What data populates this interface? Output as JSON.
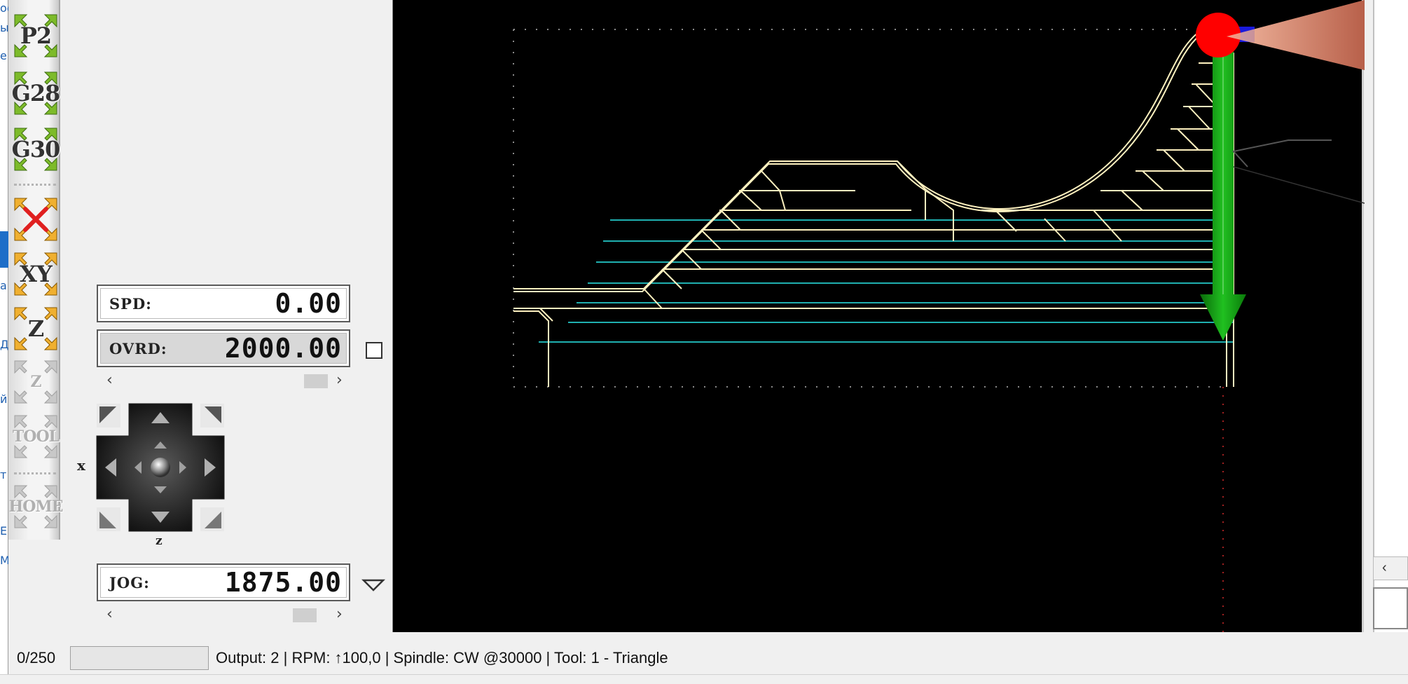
{
  "toolbar": {
    "icons": [
      {
        "label": "P2",
        "name": "p2-icon",
        "enabled": true
      },
      {
        "label": "G28",
        "name": "g28-icon",
        "enabled": true
      },
      {
        "label": "G30",
        "name": "g30-icon",
        "enabled": true
      },
      {
        "label": "",
        "name": "zero-all-icon",
        "enabled": true
      },
      {
        "label": "XY",
        "name": "zero-xy-icon",
        "enabled": true
      },
      {
        "label": "Z",
        "name": "zero-z-icon",
        "enabled": true
      },
      {
        "label": "Z",
        "name": "probe-z-icon",
        "enabled": false
      },
      {
        "label": "TOOL",
        "name": "tool-change-icon",
        "enabled": false
      },
      {
        "label": "HOME",
        "name": "home-icon",
        "enabled": false
      }
    ]
  },
  "spindle": {
    "label": "SPD:",
    "value": "0.00"
  },
  "override": {
    "label": "OVRD:",
    "value": "2000.00",
    "checked": false
  },
  "jog": {
    "label": "JOG:",
    "value": "1875.00",
    "x_label": "x",
    "z_label": "z"
  },
  "scroll": {
    "left_arrow": "‹",
    "right_arrow": "›"
  },
  "status": {
    "count": "0/250",
    "text": "Output: 2 | RPM: ↑100,0 | Spindle: CW @30000 | Tool: 1 - Triangle"
  },
  "colors": {
    "canvas_bg": "#000000",
    "toolpath": "#fff2c0",
    "feed": "#00b0b0",
    "tool_body": "#d9826a",
    "tool_tip": "#ff0000",
    "green_arrow": "#10a010",
    "divider": "#5a3a00"
  }
}
